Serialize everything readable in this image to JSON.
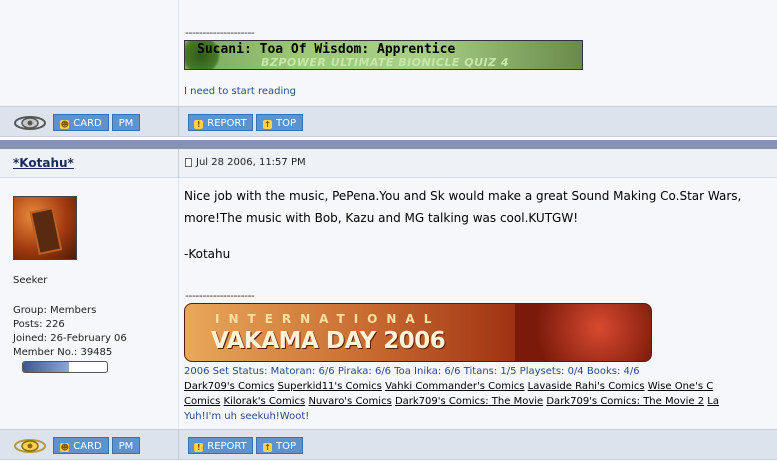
{
  "post1": {
    "signature_dashes": "--------------------",
    "banner_title": "Sucani: Toa Of Wisdom: Apprentice",
    "banner_subtitle": "BZPOWER ULTIMATE BIONICLE QUIZ 4",
    "signature_text": "I need to start reading",
    "actions": {
      "card": "CARD",
      "pm": "PM",
      "report": "REPORT",
      "top": "TOP"
    }
  },
  "post2": {
    "author": "*Kotahu*",
    "date": "Jul 28 2006, 11:57 PM",
    "body_line1": "Nice job with the music, PePena.You and Sk would make a great Sound Making Co.Star Wars,",
    "body_line2": "more!The music with Bob, Kazu and MG talking was cool.KUTGW!",
    "body_line3": "-Kotahu",
    "rank": "Seeker",
    "group": "Group: Members",
    "posts": "Posts: 226",
    "joined": "Joined: 26-February 06",
    "member_no": "Member No.: 39485",
    "signature_dashes": "--------------------",
    "banner_top": "INTERNATIONAL",
    "banner_main": "VAKAMA DAY 2006",
    "set_status": "2006 Set Status: Matoran: 6/6 Piraka: 6/6 Toa Inika: 6/6 Titans: 1/5 Playsets: 0/4 Books: 4/6",
    "links_row1": [
      "Dark709's Comics",
      "Superkid11's Comics",
      "Vahki Commander's Comics",
      "Lavaside Rahi's Comics",
      "Wise One's C"
    ],
    "links_row2": [
      "Comics",
      "Kilorak's Comics",
      "Nuvaro's Comics",
      "Dark709's Comics: The Movie",
      "Dark709's Comics: The Movie 2",
      "La"
    ],
    "footer_text": "Yuh!I'm uh seekuh!Woot!",
    "reputation_fill": 0.55,
    "actions": {
      "card": "CARD",
      "pm": "PM",
      "report": "REPORT",
      "top": "TOP"
    }
  },
  "colors": {
    "button": "#5a93d0",
    "bar": "#dce3ec",
    "divider": "#8494b0",
    "link": "#2a4a8a"
  }
}
